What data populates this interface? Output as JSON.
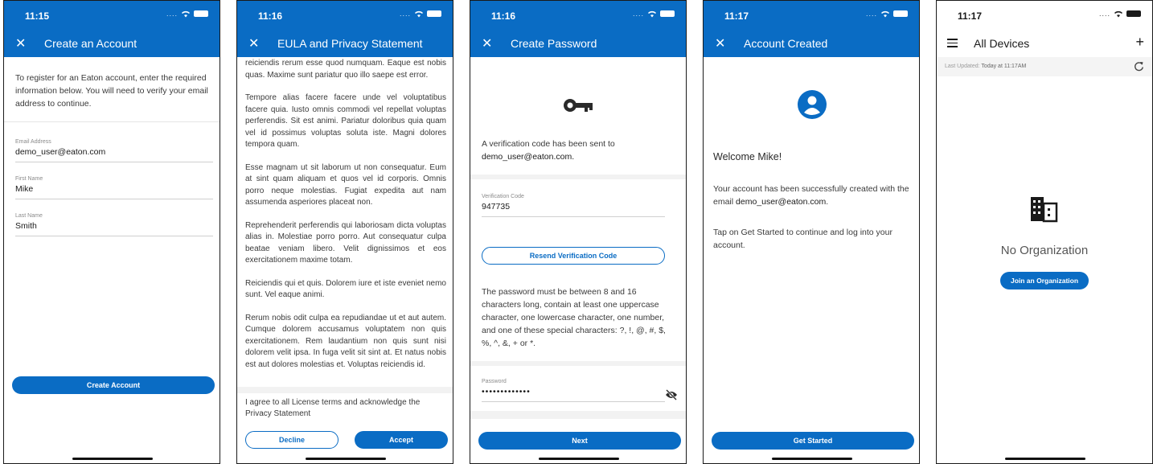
{
  "screens": {
    "create_account": {
      "time": "11:15",
      "title": "Create an Account",
      "intro": "To register for an Eaton account, enter the required information below. You will need to verify your email address to continue.",
      "fields": [
        {
          "label": "Email Address",
          "value": "demo_user@eaton.com"
        },
        {
          "label": "First Name",
          "value": "Mike"
        },
        {
          "label": "Last Name",
          "value": "Smith"
        }
      ],
      "primary_button": "Create Account"
    },
    "eula": {
      "time": "11:16",
      "title": "EULA and Privacy Statement",
      "paragraphs": [
        "reiciendis rerum esse quod numquam. Eaque est nobis quas. Maxime sunt pariatur quo illo saepe est error.",
        "Tempore alias facere facere unde vel voluptatibus facere quia. Iusto omnis commodi vel repellat voluptas perferendis. Sit est animi. Pariatur doloribus quia quam vel id possimus voluptas soluta iste. Magni dolores tempora quam.",
        "Esse magnam ut sit laborum ut non consequatur. Eum at sint quam aliquam et quos vel id corporis. Omnis porro neque molestias. Fugiat expedita aut nam assumenda asperiores placeat non.",
        "Reprehenderit perferendis qui laboriosam dicta voluptas alias in. Molestiae porro porro. Aut consequatur culpa beatae veniam libero. Velit dignissimos et eos exercitationem maxime totam.",
        "Reiciendis qui et quis. Dolorem iure et iste eveniet nemo sunt. Vel eaque animi.",
        "Rerum nobis odit culpa ea repudiandae ut et aut autem. Cumque dolorem accusamus voluptatem non quis exercitationem. Rem laudantium non quis sunt nisi dolorem velit ipsa. In fuga velit sit sint at. Et natus nobis est aut dolores molestias et. Voluptas reiciendis id."
      ],
      "agree_text": "I agree to all License terms and acknowledge the Privacy Statement",
      "decline_button": "Decline",
      "accept_button": "Accept"
    },
    "create_password": {
      "time": "11:16",
      "title": "Create Password",
      "sent_text": "A verification code has been sent to",
      "email": "demo_user@eaton.com.",
      "code_label": "Verification Code",
      "code_value": "947735",
      "resend_button": "Resend Verification Code",
      "rules_text": "The password must be between 8 and 16 characters long, contain at least one uppercase character, one lowercase character, one number, and one of these special characters: ?, !, @, #, $, %, ^, &, + or *.",
      "password_label": "Password",
      "password_value": "•••••••••••••",
      "next_button": "Next"
    },
    "account_created": {
      "time": "11:17",
      "title": "Account Created",
      "welcome": "Welcome Mike!",
      "body_prefix": "Your account has been successfully created with the email ",
      "body_email": "demo_user@eaton.com",
      "body_suffix": ".",
      "tap_text": "Tap on Get Started to continue and log into your account.",
      "get_started_button": "Get Started"
    },
    "all_devices": {
      "time": "11:17",
      "title": "All Devices",
      "last_updated": "Last Updated:",
      "last_updated_value": "Today at 11:17AM",
      "empty_title": "No Organization",
      "join_button": "Join an Organization"
    }
  },
  "colors": {
    "brand": "#0a6cc4",
    "text": "#3a3a3a"
  },
  "icons": [
    "close-icon",
    "wifi-icon",
    "battery-icon",
    "key-icon",
    "account-circle-icon",
    "visibility-off-icon",
    "menu-icon",
    "add-icon",
    "refresh-icon",
    "business-icon"
  ]
}
